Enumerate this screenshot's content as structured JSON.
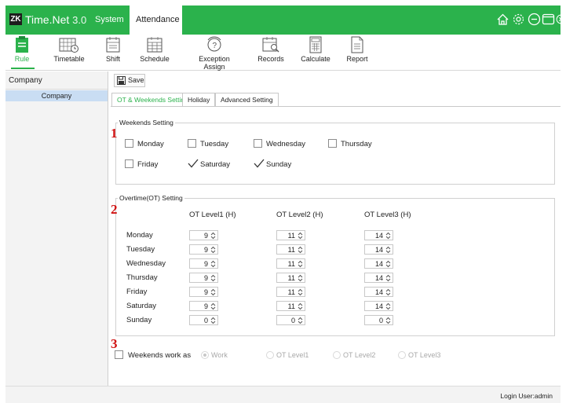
{
  "app": {
    "logo": "ZK",
    "title": "Time.Net",
    "version": "3.0"
  },
  "menu": {
    "system": "System",
    "attendance": "Attendance"
  },
  "toolbar": [
    {
      "label": "Rule",
      "icon": "rule-icon"
    },
    {
      "label": "Timetable",
      "icon": "timetable-icon"
    },
    {
      "label": "Shift",
      "icon": "shift-icon"
    },
    {
      "label": "Schedule",
      "icon": "schedule-icon"
    },
    {
      "label": "Exception Assign",
      "icon": "exception-assign-icon"
    },
    {
      "label": "Records",
      "icon": "records-icon"
    },
    {
      "label": "Calculate",
      "icon": "calculate-icon"
    },
    {
      "label": "Report",
      "icon": "report-icon"
    }
  ],
  "left": {
    "header": "Company",
    "selected": "Company"
  },
  "save": "Save",
  "subtabs": [
    "OT & Weekends Setting",
    "Holiday",
    "Advanced Setting"
  ],
  "weekends": {
    "title": "Weekends Setting",
    "marker": "1",
    "days": [
      {
        "label": "Monday",
        "checked": false
      },
      {
        "label": "Tuesday",
        "checked": false
      },
      {
        "label": "Wednesday",
        "checked": false
      },
      {
        "label": "Thursday",
        "checked": false
      },
      {
        "label": "Friday",
        "checked": false
      },
      {
        "label": "Saturday",
        "checked": true
      },
      {
        "label": "Sunday",
        "checked": true
      }
    ]
  },
  "overtime": {
    "title": "Overtime(OT) Setting",
    "marker": "2",
    "headers": [
      "OT Level1 (H)",
      "OT Level2 (H)",
      "OT Level3 (H)"
    ],
    "rows": [
      {
        "day": "Monday",
        "values": [
          "9",
          "11",
          "14"
        ]
      },
      {
        "day": "Tuesday",
        "values": [
          "9",
          "11",
          "14"
        ]
      },
      {
        "day": "Wednesday",
        "values": [
          "9",
          "11",
          "14"
        ]
      },
      {
        "day": "Thursday",
        "values": [
          "9",
          "11",
          "14"
        ]
      },
      {
        "day": "Friday",
        "values": [
          "9",
          "11",
          "14"
        ]
      },
      {
        "day": "Saturday",
        "values": [
          "9",
          "11",
          "14"
        ]
      },
      {
        "day": "Sunday",
        "values": [
          "0",
          "0",
          "0"
        ]
      }
    ]
  },
  "weekend_work": {
    "marker": "3",
    "label": "Weekends work as",
    "options": [
      "Work",
      "OT Level1",
      "OT Level2",
      "OT Level3"
    ],
    "selected": "Work"
  },
  "status": {
    "login": "Login User:admin"
  },
  "colors": {
    "brand": "#2bb24c",
    "marker": "#d01010",
    "selection": "#c9ddf3"
  }
}
